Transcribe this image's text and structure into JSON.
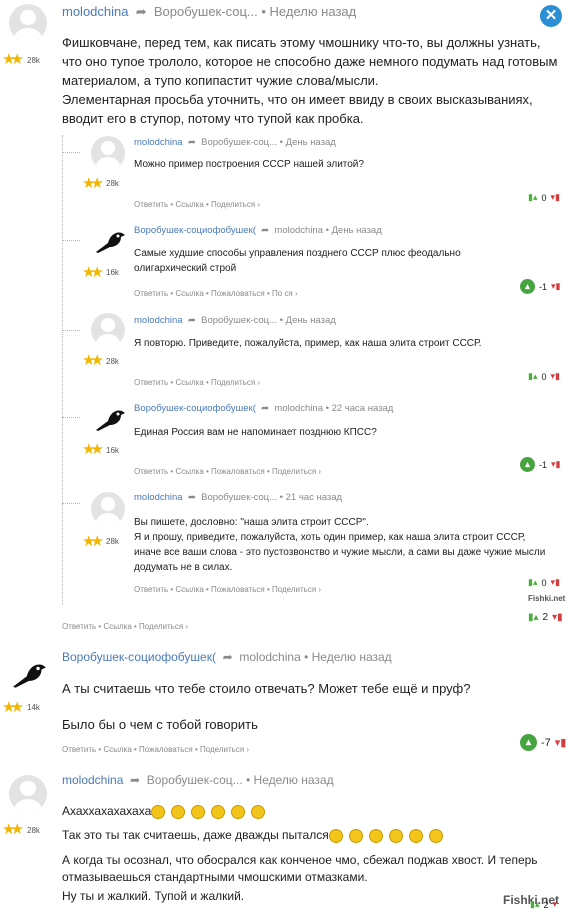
{
  "comments": {
    "c1": {
      "user": "molodchina",
      "reply_to": "Воробушек-соц...",
      "time": "• Неделю назад",
      "rating": "28k",
      "text": "Фишковчане, перед тем, как писать этому чмошнику что-то, вы должны узнать, что оно тупое трололо, которое не способно даже немного подумать над готовым материалом, а тупо копипастит чужие слова/мысли.\nЭлементарная просьба уточнить, что он имеет ввиду в своих высказываниях, вводит его в ступор, потому что тупой как пробка.",
      "actions": "Ответить • Ссылка • Поделиться ›",
      "vote": "2"
    },
    "r1": {
      "user": "molodchina",
      "reply_to": "Воробушек-соц...",
      "time": "• День назад",
      "rating": "28k",
      "text": "Можно пример построения СССР нашей элитой?",
      "actions": "Ответить • Ссылка • Поделиться ›",
      "vote": "0"
    },
    "r2": {
      "user": "Воробушек-социофобушек(",
      "reply_to": "molodchina",
      "time": "• День назад",
      "rating": "16k",
      "text": "Самые худшие способы управления позднего СССР плюс феодально олигархический строй",
      "actions": "Ответить • Ссылка • Пожаловаться • По    ся ›",
      "vote": "-1"
    },
    "r3": {
      "user": "molodchina",
      "reply_to": "Воробушек-соц...",
      "time": "• День назад",
      "rating": "28k",
      "text": "Я повторю. Приведите, пожалуйста, пример, как наша элита строит СССР.",
      "actions": "Ответить • Ссылка • Поделиться ›",
      "vote": "0"
    },
    "r4": {
      "user": "Воробушек-социофобушек(",
      "reply_to": "molodchina",
      "time": "• 22 часа назад",
      "rating": "16k",
      "text": "Единая Россия вам не напоминает позднюю КПСС?",
      "actions": "Ответить • Ссылка • Пожаловаться • Поделиться ›",
      "vote": "-1"
    },
    "r5": {
      "user": "molodchina",
      "reply_to": "Воробушек-соц...",
      "time": "• 21 час назад",
      "rating": "28k",
      "text": "Вы пишете, дословно: \"наша элита строит СССР\".\nЯ и прошу, приведите, пожалуйста, хоть один пример, как наша элита строит СССР, иначе все ваши слова - это пустозвонство и чужие мысли, а сами вы даже чужие мысли додумать не в силах.",
      "actions": "Ответить • Ссылка • Пожаловаться • Поделиться ›",
      "vote": "0"
    },
    "c2": {
      "user": "Воробушек-социофобушек(",
      "reply_to": "molodchina",
      "time": "• Неделю назад",
      "rating": "14k",
      "text1": "А ты считаешь что тебе стоило отвечать? Может тебе ещё и пруф?",
      "text2": "Было бы о чем с тобой говорить",
      "actions": "Ответить • Ссылка • Пожаловаться • Поделиться ›",
      "vote": "-7"
    },
    "c3": {
      "user": "molodchina",
      "reply_to": "Воробушек-соц...",
      "time": "• Неделю назад",
      "rating": "28k",
      "line1": "Ахаххахахахаха",
      "line2": "Так это ты так считаешь, даже дважды пытался",
      "line3": "А когда ты осознал, что обосрался как конченое чмо, сбежал поджав хвост. И теперь отмазываешься стандартными чмошскими отмазками.",
      "line4": "Ну ты и жалкий. Тупой и жалкий."
    }
  },
  "watermark_small": "Fishki.net",
  "watermark_big": "Fishki.net",
  "vote_bottom": "2",
  "icons": {
    "close": "close-icon",
    "reply": "reply-arrow-icon",
    "up": "thumb-up-icon",
    "down": "thumb-down-icon",
    "crow": "crow-avatar-icon"
  }
}
